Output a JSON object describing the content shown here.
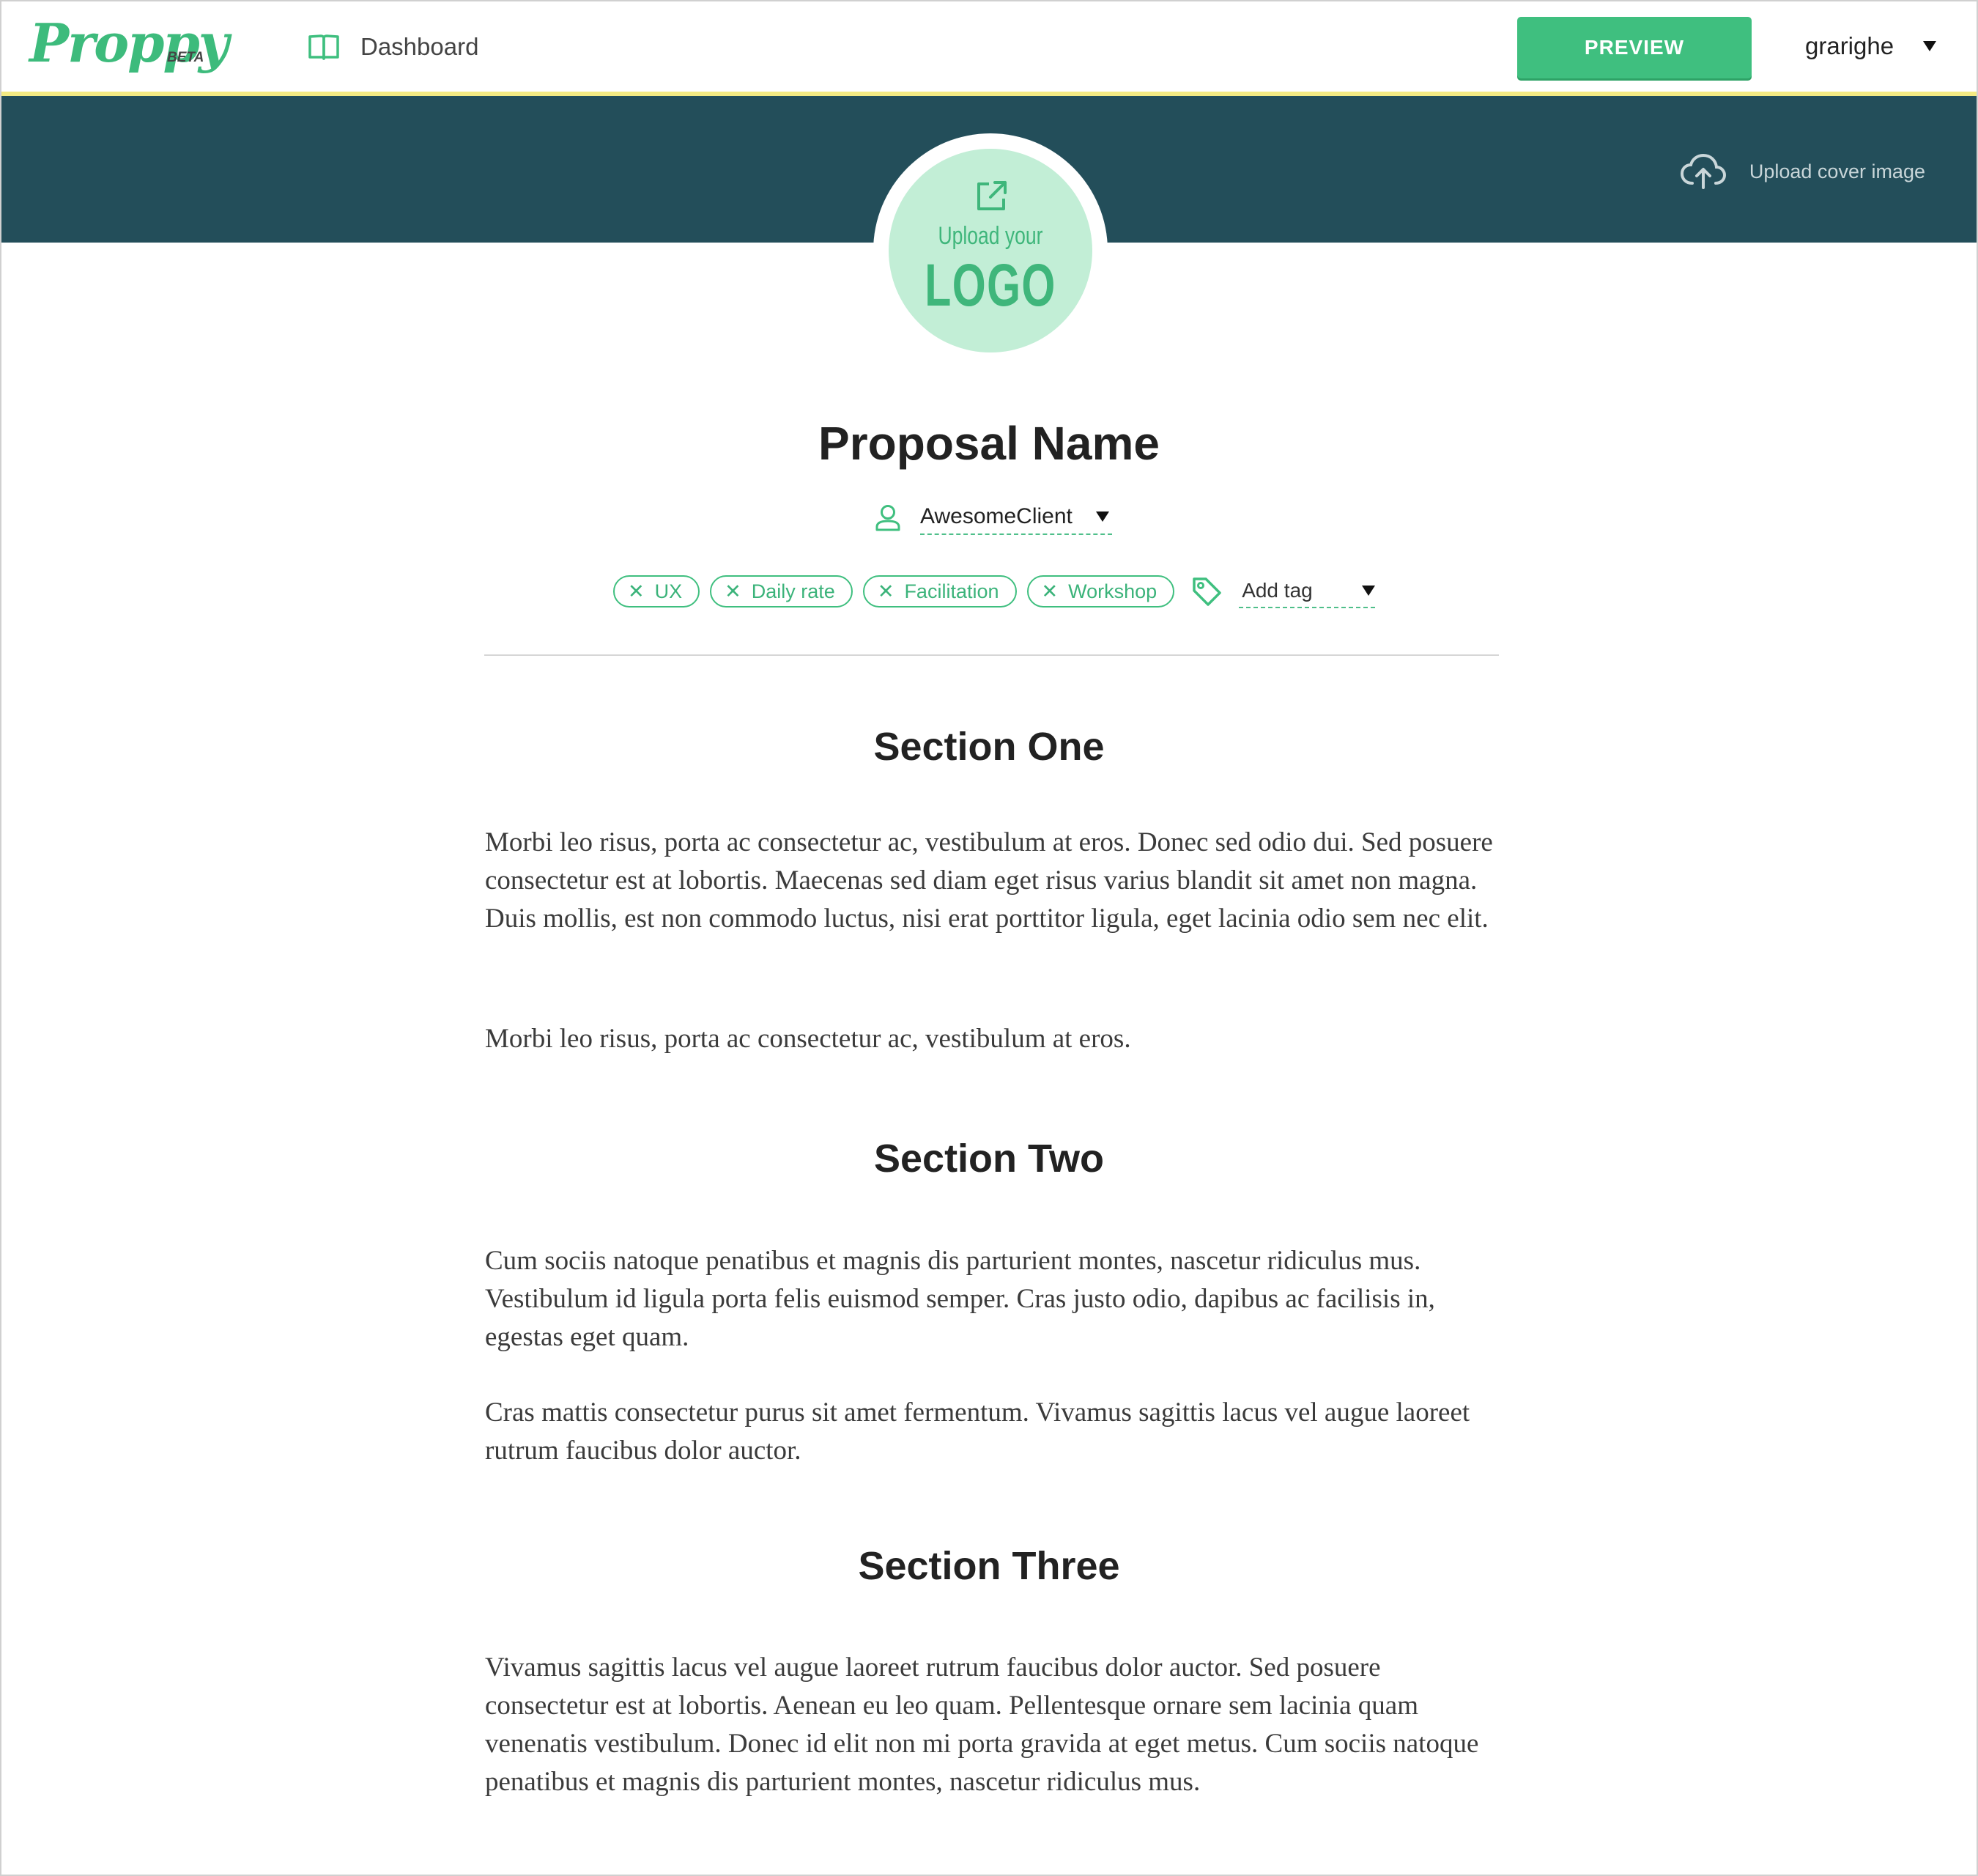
{
  "app": {
    "brand": "Proppy",
    "badge": "BETA",
    "nav_dashboard": "Dashboard",
    "preview_label": "PREVIEW",
    "username": "grarighe",
    "accent_color": "#3fbf7f",
    "cover_color": "#234e5a"
  },
  "cover": {
    "upload_cover_label": "Upload cover image",
    "logo_line1": "Upload your",
    "logo_line2": "LOGO"
  },
  "proposal": {
    "title": "Proposal Name",
    "client": "AwesomeClient",
    "tags": [
      "UX",
      "Daily rate",
      "Facilitation",
      "Workshop"
    ],
    "add_tag_placeholder": "Add tag"
  },
  "sections": [
    {
      "title": "Section One",
      "paragraphs": [
        "Morbi leo risus, porta ac consectetur ac, vestibulum at eros. Donec sed odio dui. Sed posuere consectetur est at lobortis. Maecenas sed diam eget risus varius blandit sit amet non magna. Duis mollis, est non commodo luctus, nisi erat porttitor ligula, eget lacinia odio sem nec elit.",
        "Morbi leo risus, porta ac consectetur ac, vestibulum at eros."
      ]
    },
    {
      "title": "Section Two",
      "paragraphs": [
        "Cum sociis natoque penatibus et magnis dis parturient montes, nascetur ridiculus mus. Vestibulum id ligula porta felis euismod semper. Cras justo odio, dapibus ac facilisis in, egestas eget quam.",
        "Cras mattis consectetur purus sit amet fermentum. Vivamus sagittis lacus vel augue laoreet rutrum faucibus dolor auctor."
      ]
    },
    {
      "title": "Section Three",
      "paragraphs": [
        "Vivamus sagittis lacus vel augue laoreet rutrum faucibus dolor auctor. Sed posuere consectetur est at lobortis. Aenean eu leo quam. Pellentesque ornare sem lacinia quam venenatis vestibulum. Donec id elit non mi porta gravida at eget metus. Cum sociis natoque penatibus et magnis dis parturient montes, nascetur ridiculus mus."
      ]
    }
  ]
}
